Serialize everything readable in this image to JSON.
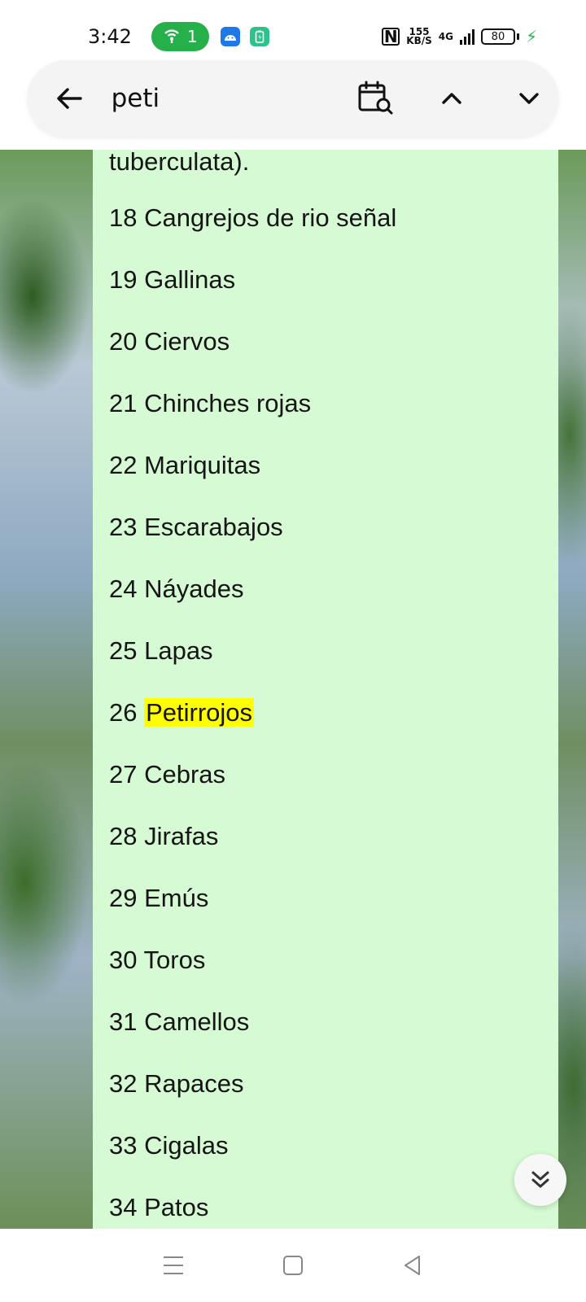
{
  "status_bar": {
    "time": "3:42",
    "hotspot_count": "1",
    "speed_value": "155",
    "speed_unit": "KB/S",
    "network": "4G",
    "battery_level": "80"
  },
  "find_bar": {
    "query": "peti"
  },
  "content": {
    "items": [
      "tuberculata).",
      "18 Cangrejos de rio señal",
      "19 Gallinas",
      "20 Ciervos",
      "21 Chinches rojas",
      "22 Mariquitas",
      "23 Escarabajos",
      "24 Náyades",
      "25 Lapas",
      "27 Cebras",
      "28 Jirafas",
      "29 Emús",
      "30 Toros",
      "31 Camellos",
      "32 Rapaces",
      "33 Cigalas",
      "34 Patos"
    ],
    "highlight_item": {
      "number": "26",
      "match": "Petirrojos"
    }
  },
  "colors": {
    "card_bg": "#d6fbd4",
    "highlight": "#ffff00",
    "hotspot_pill": "#25b04a"
  }
}
